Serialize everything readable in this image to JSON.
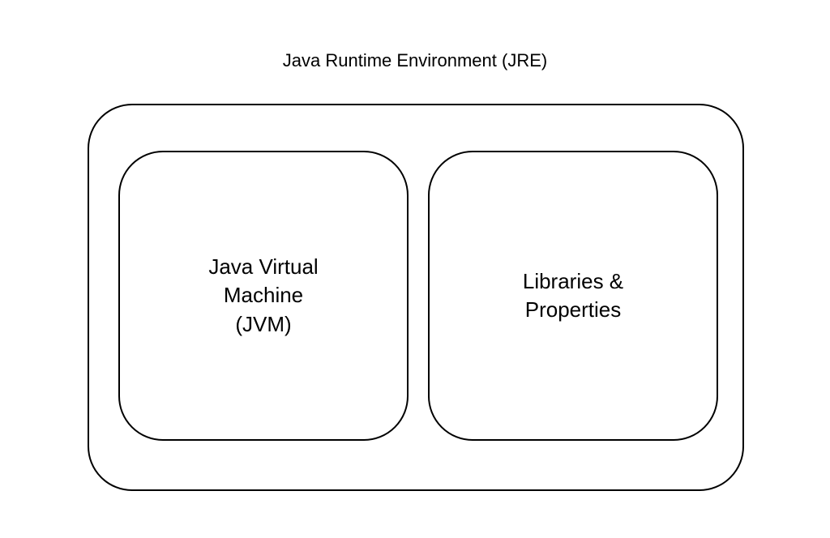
{
  "diagram": {
    "title": "Java Runtime Environment (JRE)",
    "components": {
      "left": "Java Virtual\nMachine\n(JVM)",
      "right": "Libraries &\nProperties"
    }
  }
}
